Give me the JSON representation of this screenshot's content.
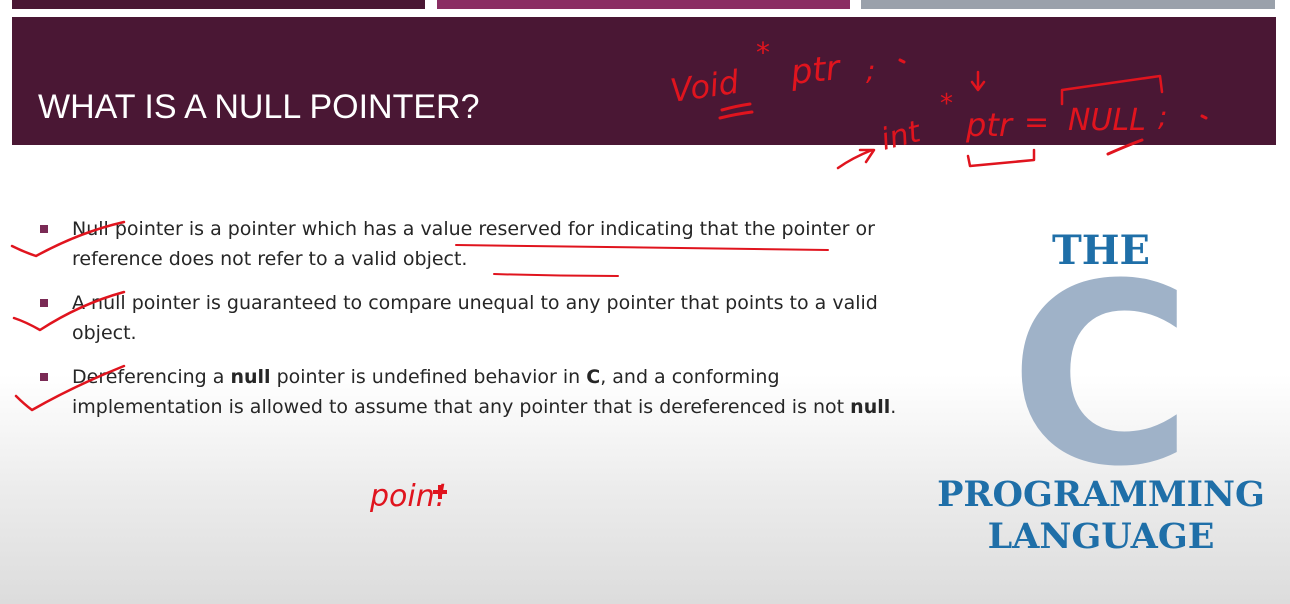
{
  "slide": {
    "title": "WHAT IS A NULL POINTER?",
    "bullets": [
      {
        "parts": [
          {
            "text": "Null pointer is a pointer which has a value reserved for indicating that the pointer or reference does not refer to a valid object.",
            "bold": false
          }
        ]
      },
      {
        "parts": [
          {
            "text": "A null pointer is guaranteed to compare unequal to any pointer that points to a valid object.",
            "bold": false
          }
        ]
      },
      {
        "parts": [
          {
            "text": "Dereferencing a ",
            "bold": false
          },
          {
            "text": "null",
            "bold": true
          },
          {
            "text": " pointer is undefined behavior in ",
            "bold": false
          },
          {
            "text": "C",
            "bold": true
          },
          {
            "text": ", and a conforming implementation is allowed to assume that any pointer that is dereferenced is not ",
            "bold": false
          },
          {
            "text": "null",
            "bold": true
          },
          {
            "text": ".",
            "bold": false
          }
        ]
      }
    ]
  },
  "logo": {
    "the": "THE",
    "letter": "C",
    "line1": "PROGRAMMING",
    "line2": "LANGUAGE"
  },
  "annotations": {
    "void_word": "Void",
    "star1": "*",
    "ptr1": "ptr",
    "semi1": ";",
    "int_word": "int",
    "star2": "*",
    "ptr2": "ptr",
    "eq": "=",
    "null_word": "NULL",
    "semi2": ";",
    "point_word": "poin!"
  },
  "colors": {
    "title_bar": "#4a1734",
    "strip_1": "#4a1734",
    "strip_2": "#8a2e63",
    "strip_3": "#9aa1ab",
    "bullet_marker": "#7a2a55",
    "body_text": "#262626",
    "logo_blue": "#1f6fa8",
    "logo_c_gray": "#9fb2c8",
    "ink_red": "#e0141e"
  }
}
